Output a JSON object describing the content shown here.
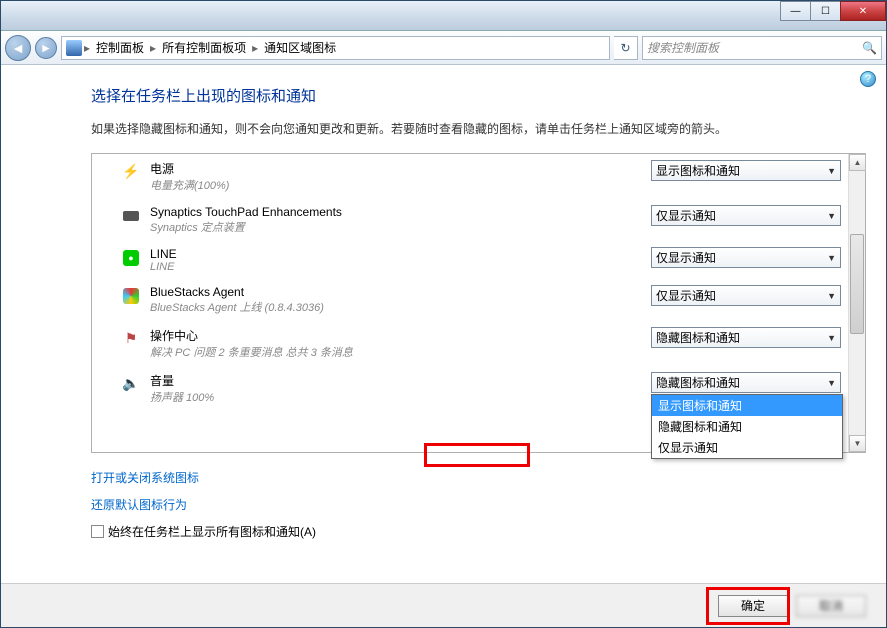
{
  "titlebar": {
    "min": "—",
    "max": "☐",
    "close": "✕"
  },
  "nav": {
    "back": "◄",
    "fwd": "►"
  },
  "breadcrumb": {
    "sep": "▸",
    "items": [
      "控制面板",
      "所有控制面板项",
      "通知区域图标"
    ]
  },
  "refresh": "↻",
  "search": {
    "placeholder": "搜索控制面板",
    "icon": "🔍"
  },
  "help": "?",
  "page_title": "选择在任务栏上出现的图标和通知",
  "page_desc": "如果选择隐藏图标和通知，则不会向您通知更改和更新。若要随时查看隐藏的图标，请单击任务栏上通知区域旁的箭头。",
  "rows": [
    {
      "icon": "⚡",
      "name": "电源",
      "sub": "电量充满(100%)",
      "sel": "显示图标和通知"
    },
    {
      "icon": "tp",
      "name": "Synaptics TouchPad Enhancements",
      "sub": "Synaptics 定点装置",
      "sel": "仅显示通知"
    },
    {
      "icon": "L",
      "name": "LINE",
      "sub": "LINE",
      "sel": "仅显示通知"
    },
    {
      "icon": "bs",
      "name": "BlueStacks Agent",
      "sub": "BlueStacks Agent 上线 (0.8.4.3036)",
      "sel": "仅显示通知"
    },
    {
      "icon": "⚑",
      "name": "操作中心",
      "sub": "解决 PC 问题  2 条重要消息  总共 3 条消息",
      "sel": "隐藏图标和通知"
    },
    {
      "icon": "🔈",
      "name": "音量",
      "sub": "扬声器 100%",
      "sel": "隐藏图标和通知"
    }
  ],
  "dropdown": {
    "opt1": "显示图标和通知",
    "opt2": "隐藏图标和通知",
    "opt3": "仅显示通知"
  },
  "link1": "打开或关闭系统图标",
  "link2": "还原默认图标行为",
  "checkbox_label": "始终在任务栏上显示所有图标和通知(A)",
  "btn_ok": "确定",
  "btn_cancel": "取消",
  "scroll": {
    "up": "▲",
    "down": "▼"
  }
}
